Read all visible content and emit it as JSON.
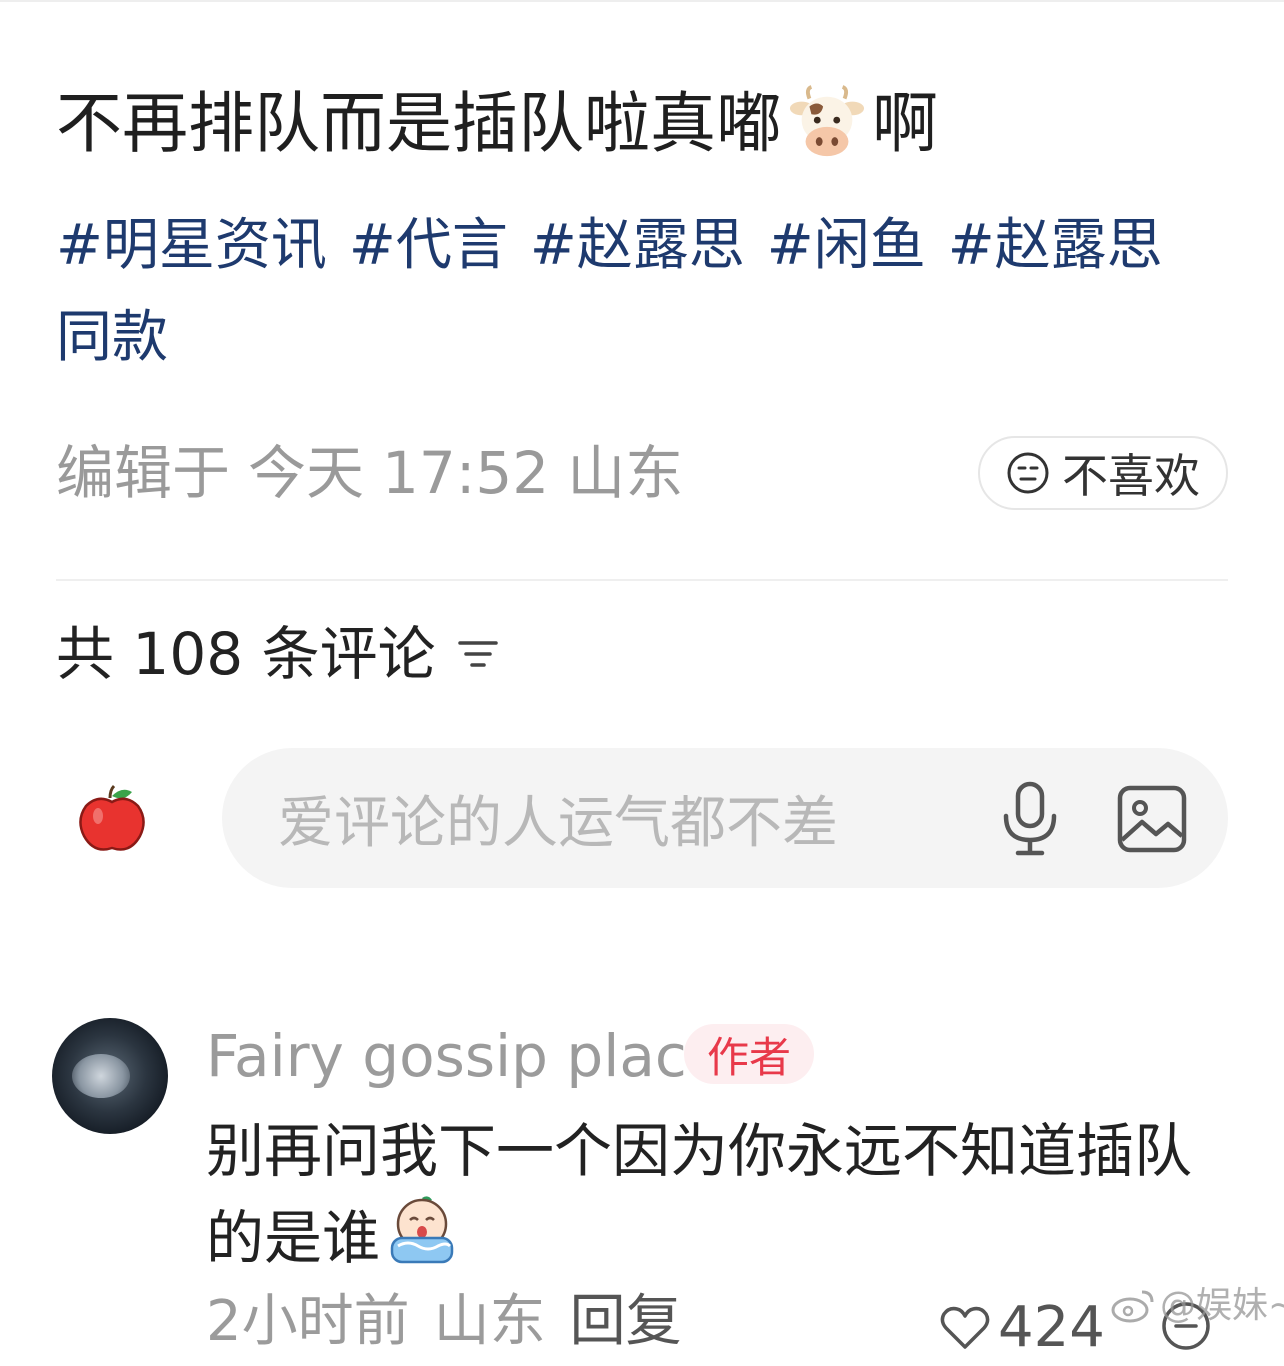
{
  "post": {
    "title_before": "不再排队而是插队啦真嘟",
    "title_emoji": "cow-face-emoji",
    "title_after": "啊",
    "tags": [
      "#明星资讯",
      "#代言",
      "#赵露思",
      "#闲鱼",
      "#赵露思同款"
    ],
    "meta": {
      "edited_label": "编辑于",
      "day": "今天",
      "time": "17:52",
      "location": "山东"
    },
    "dislike_label": "不喜欢"
  },
  "comments_section": {
    "count_label": "共 108 条评论",
    "input_placeholder": "爱评论的人运气都不差"
  },
  "comment": {
    "username": "Fairy gossip place",
    "author_badge": "作者",
    "text": "别再问我下一个因为你永远不知道插队的是谁",
    "text_emoji": "crying-emoji",
    "time_ago": "2小时前",
    "location": "山东",
    "reply_label": "回复",
    "like_count": "424"
  },
  "watermark": "@娱妹~",
  "colors": {
    "tag": "#1e3a6e",
    "badge_text": "#e8394a",
    "badge_bg": "#fdeef0",
    "input_bg": "#f4f4f4",
    "muted": "#9b9b9b"
  }
}
